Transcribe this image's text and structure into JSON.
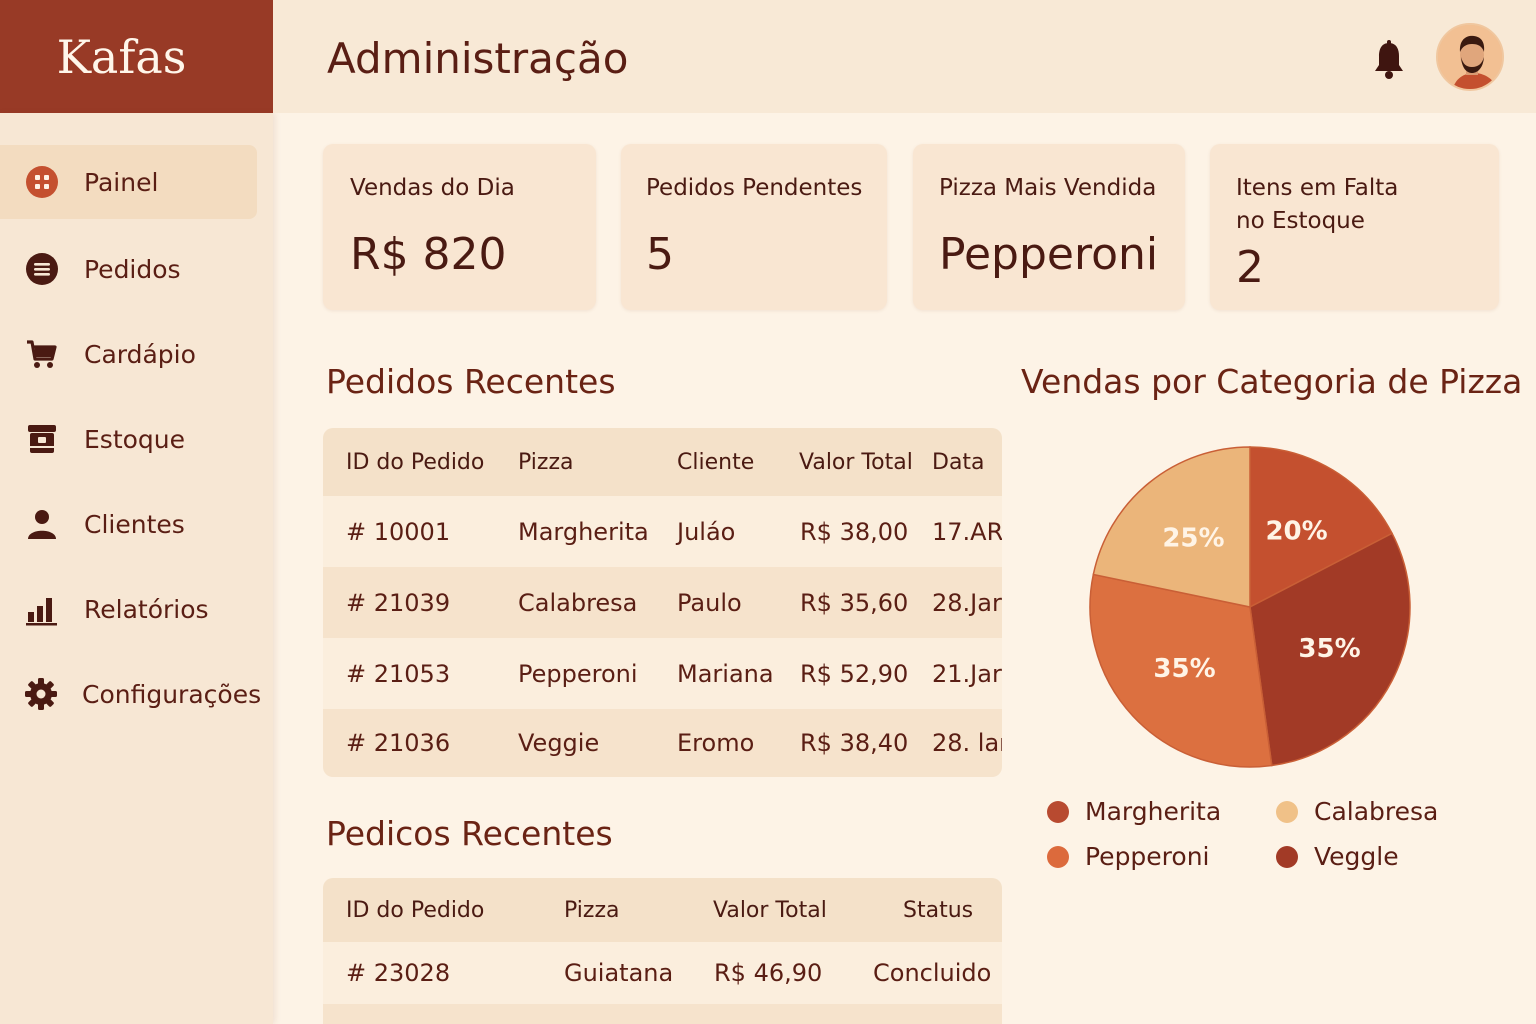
{
  "app": {
    "brand": "Kafas"
  },
  "header": {
    "title": "Administração"
  },
  "sidebar": {
    "items": [
      {
        "label": "Painel",
        "icon": "dashboard-icon",
        "active": true
      },
      {
        "label": "Pedidos",
        "icon": "orders-icon"
      },
      {
        "label": "Cardápio",
        "icon": "cart-icon"
      },
      {
        "label": "Estoque",
        "icon": "inventory-icon"
      },
      {
        "label": "Clientes",
        "icon": "user-icon"
      },
      {
        "label": "Relatórios",
        "icon": "bar-chart-icon"
      },
      {
        "label": "Configurações",
        "icon": "gear-icon"
      }
    ]
  },
  "cards": [
    {
      "label": "Vendas do Dia",
      "value": "R$ 820"
    },
    {
      "label": "Pedidos Pendentes",
      "value": "5"
    },
    {
      "label": "Pizza Mais Vendida",
      "value": "Pepperoni"
    },
    {
      "label": "Itens em Falta\nno Estoque",
      "value": "2"
    }
  ],
  "recent_orders": {
    "title": "Pedidos Recentes",
    "columns": [
      "ID do Pedido",
      "Pizza",
      "Cliente",
      "Valor Total",
      "Data"
    ],
    "rows": [
      [
        "# 10001",
        "Margherita",
        "Juláo",
        "R$ 38,00",
        "17.AR"
      ],
      [
        "# 21039",
        "Calabresa",
        "Paulo",
        "R$ 35,60",
        "28.Jar"
      ],
      [
        "# 21053",
        "Pepperoni",
        "Mariana",
        "R$ 52,90",
        "21.Jar"
      ],
      [
        "# 21036",
        "Veggie",
        "Eromo",
        "R$ 38,40",
        "28. lar"
      ]
    ]
  },
  "recent_orders_2": {
    "title": "Pedicos Recentes",
    "columns": [
      "ID do Pedido",
      "Pizza",
      "Valor Total",
      "Status"
    ],
    "rows": [
      [
        "# 23028",
        "Guiatana",
        "R$ 46,90",
        "Concluido"
      ]
    ]
  },
  "chart_data": {
    "type": "pie",
    "title": "Vendas por Categoria de Pizza",
    "slices": [
      {
        "label": "20%",
        "value": 20,
        "color": "#c4502f"
      },
      {
        "label": "35%",
        "value": 35,
        "color": "#a23a26"
      },
      {
        "label": "35%",
        "value": 35,
        "color": "#dc7040"
      },
      {
        "label": "25%",
        "value": 25,
        "color": "#ebb57a"
      }
    ],
    "legend": [
      {
        "name": "Margherita",
        "color": "#b84a30"
      },
      {
        "name": "Calabresa",
        "color": "#f0c188"
      },
      {
        "name": "Pepperoni",
        "color": "#dc6a3c"
      },
      {
        "name": "Veggle",
        "color": "#a23a26"
      }
    ]
  }
}
